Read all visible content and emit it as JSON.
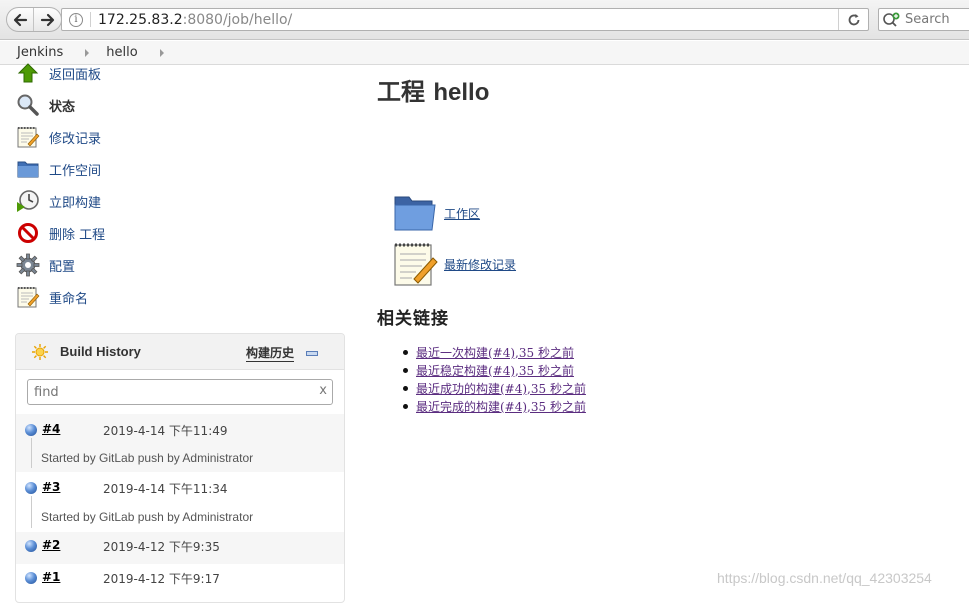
{
  "browser": {
    "url_host": "172.25.83.2",
    "url_rest": ":8080/job/hello/",
    "search_placeholder": "Search"
  },
  "breadcrumbs": [
    {
      "label": "Jenkins"
    },
    {
      "label": "hello"
    }
  ],
  "tasks": [
    {
      "label": "返回面板",
      "icon": "up-arrow-icon"
    },
    {
      "label": "状态",
      "icon": "magnifier-icon"
    },
    {
      "label": "修改记录",
      "icon": "notepad-icon"
    },
    {
      "label": "工作空间",
      "icon": "folder-icon"
    },
    {
      "label": "立即构建",
      "icon": "clock-play-icon"
    },
    {
      "label": "删除 工程",
      "icon": "no-entry-icon"
    },
    {
      "label": "配置",
      "icon": "gear-icon"
    },
    {
      "label": "重命名",
      "icon": "notepad-icon"
    }
  ],
  "build_history": {
    "title": "Build History",
    "trend_label": "构建历史",
    "find_placeholder": "find",
    "clear_label": "x",
    "builds": [
      {
        "number": "#4",
        "time": "2019-4-14 下午11:49",
        "desc": "Started by GitLab push by Administrator"
      },
      {
        "number": "#3",
        "time": "2019-4-14 下午11:34",
        "desc": "Started by GitLab push by Administrator"
      },
      {
        "number": "#2",
        "time": "2019-4-12 下午9:35",
        "desc": ""
      },
      {
        "number": "#1",
        "time": "2019-4-12 下午9:17",
        "desc": ""
      }
    ]
  },
  "main": {
    "title_prefix": "工程",
    "title_name": "hello",
    "workspace_link": "工作区",
    "changes_link": "最新修改记录",
    "related_title": "相关链接",
    "permalinks": [
      "最近一次构建(#4),35 秒之前",
      "最近稳定构建(#4),35 秒之前",
      "最近成功的构建(#4),35 秒之前",
      "最近完成的构建(#4),35 秒之前"
    ]
  },
  "watermark": "https://blog.csdn.net/qq_42303254",
  "colors": {
    "link": "#204a87",
    "visited_link": "#5b2d80",
    "build_ball": "#3465a4"
  }
}
